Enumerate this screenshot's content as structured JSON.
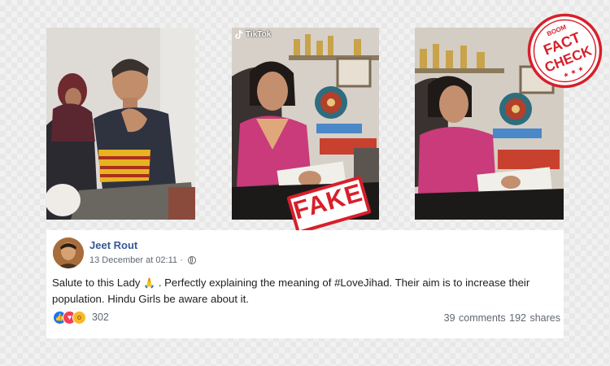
{
  "brand": "BOOM",
  "fact_check": {
    "line1": "FACT",
    "line2": "CHECK"
  },
  "tiktok": {
    "label": "TikTok"
  },
  "fake_stamp": "FAKE",
  "post": {
    "author": "Jeet Rout",
    "date": "13 December at 02:11",
    "separator": "·",
    "text_a": "Salute to this Lady",
    "pray_emoji": "🙏",
    "text_b": " . Perfectly explaining the meaning of #LoveJihad. Their aim is to increase their population. Hindu Girls be aware about it.",
    "reaction_count": "302",
    "comments": "39 comments",
    "shares": "192 shares"
  },
  "icons": [
    "tiktok-icon",
    "globe-icon",
    "like-icon",
    "love-icon",
    "wow-icon"
  ],
  "colors": {
    "fact_red": "#d81f2a",
    "fb_blue": "#385898",
    "like_blue": "#1877f2",
    "love_red": "#f33e58",
    "wow_yellow": "#f7b928"
  }
}
